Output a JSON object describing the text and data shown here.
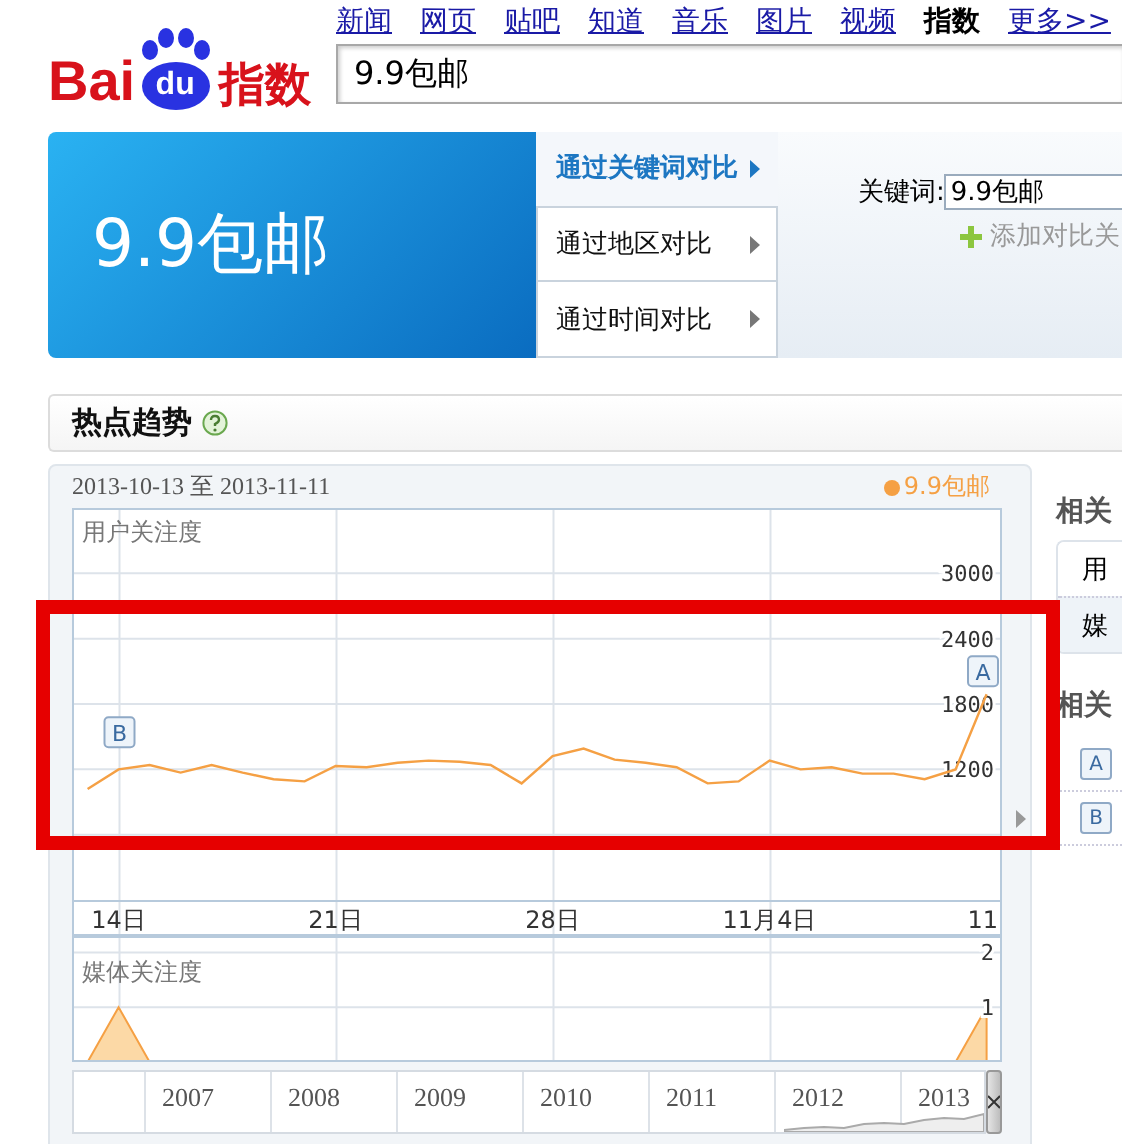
{
  "nav": {
    "links": [
      {
        "label": "新闻",
        "selected": false
      },
      {
        "label": "网页",
        "selected": false
      },
      {
        "label": "贴吧",
        "selected": false
      },
      {
        "label": "知道",
        "selected": false
      },
      {
        "label": "音乐",
        "selected": false
      },
      {
        "label": "图片",
        "selected": false
      },
      {
        "label": "视频",
        "selected": false
      },
      {
        "label": "指数",
        "selected": true
      },
      {
        "label": "更多>>",
        "selected": false
      }
    ]
  },
  "logo": {
    "text_left": "Bai",
    "badge": "du",
    "text_right": "指数"
  },
  "search": {
    "value": "9.9包邮"
  },
  "banner": {
    "keyword": "9.9包邮"
  },
  "compare_menu": [
    {
      "label": "通过关键词对比",
      "selected": true
    },
    {
      "label": "通过地区对比",
      "selected": false
    },
    {
      "label": "通过时间对比",
      "selected": false
    }
  ],
  "keyword_form": {
    "label": "关键词:",
    "value": "9.9包邮",
    "add_link": "添加对比关"
  },
  "section": {
    "title": "热点趋势"
  },
  "trend_panel": {
    "date_range": "2013-10-13 至 2013-11-11",
    "chart_data": {
      "type": "line",
      "title": "用户关注度",
      "categories": [
        null,
        "14日",
        null,
        null,
        null,
        null,
        null,
        null,
        "21日",
        null,
        null,
        null,
        null,
        null,
        null,
        "28日",
        null,
        null,
        null,
        null,
        null,
        null,
        "11月4日",
        null,
        null,
        null,
        null,
        null,
        null,
        "11"
      ],
      "ylim": [
        0,
        3600
      ],
      "yticks": [
        1200,
        1800,
        2400,
        3000
      ],
      "series": [
        {
          "name": "9.9包邮",
          "color": "#f5a044",
          "values": [
            1020,
            1200,
            1240,
            1170,
            1240,
            1170,
            1110,
            1090,
            1230,
            1220,
            1260,
            1280,
            1270,
            1240,
            1070,
            1320,
            1390,
            1290,
            1260,
            1220,
            1070,
            1090,
            1280,
            1200,
            1220,
            1160,
            1160,
            1110,
            1200,
            1890
          ]
        }
      ],
      "grid": true,
      "annotations": [
        {
          "x": "14日",
          "text": "B"
        },
        "A"
      ]
    },
    "media_chart": {
      "chart_data": {
        "type": "area",
        "title": "媒体关注度",
        "categories": [
          null,
          null,
          null,
          null,
          null,
          null,
          null,
          null,
          null,
          null,
          null,
          null,
          null,
          null,
          null,
          null,
          null,
          null,
          null,
          null,
          null,
          null,
          null,
          null,
          null,
          null,
          null,
          null,
          null,
          null
        ],
        "ylim": [
          0,
          2.3
        ],
        "yticks": [
          1,
          2
        ],
        "grid": true,
        "series": [
          {
            "color": "#f5a044",
            "values": [
              0,
              1,
              0,
              0,
              0,
              0,
              0,
              0,
              0,
              0,
              0,
              0,
              0,
              0,
              0,
              0,
              0,
              0,
              0,
              0,
              0,
              0,
              0,
              0,
              0,
              0,
              0,
              0,
              0,
              1
            ]
          }
        ]
      }
    },
    "years": [
      "2007",
      "2008",
      "2009",
      "2010",
      "2011",
      "2012",
      "2013"
    ]
  },
  "related": {
    "heading_top": "相关",
    "tabs": [
      {
        "label": "用",
        "selected": true
      },
      {
        "label": "媒",
        "selected": false
      }
    ],
    "heading_bottom": "相关",
    "markers": [
      "A",
      "B"
    ]
  },
  "overlay": {
    "kind": "highlight_frame"
  }
}
